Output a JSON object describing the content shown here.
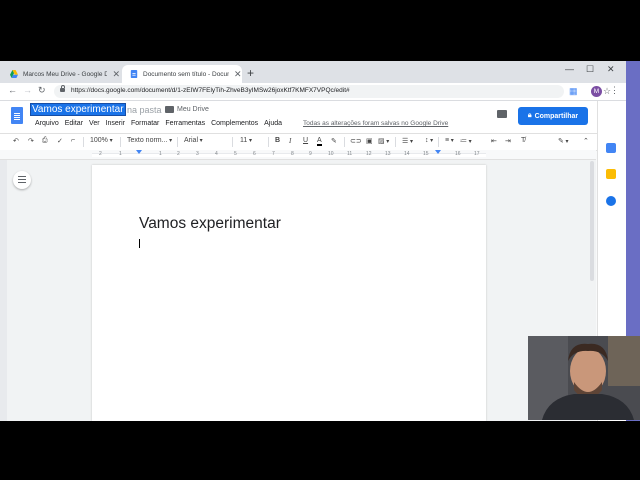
{
  "colors": {
    "accent": "#1a73e8",
    "avatar": "#7b4ea3",
    "docs_blue": "#4285f4"
  },
  "browser": {
    "tabs": [
      {
        "label": "Marcos Meu Drive - Google Drive",
        "icon": "google-drive-icon",
        "active": false
      },
      {
        "label": "Documento sem título - Docum",
        "icon": "google-docs-icon",
        "active": true
      }
    ],
    "url": "https://docs.google.com/document/d/1-zEIW7FElyTih-ZhveB3yIMSw26joxKtf7KMFX7VPQc/edit#",
    "profile_initial": "M"
  },
  "docs": {
    "title": "Vamos experimentar",
    "move_hint": "na pasta",
    "folder": "Meu Drive",
    "menu": [
      "Arquivo",
      "Editar",
      "Ver",
      "Inserir",
      "Formatar",
      "Ferramentas",
      "Complementos",
      "Ajuda"
    ],
    "saved_status": "Todas as alterações foram salvas no Google Drive",
    "share_label": "Compartilhar",
    "avatar_initial": "M",
    "toolbar": {
      "zoom": "100%",
      "style": "Texto norm...",
      "font": "Arial",
      "size": "11"
    },
    "ruler_numbers": [
      "2",
      "1",
      "1",
      "2",
      "3",
      "4",
      "5",
      "6",
      "7",
      "8",
      "9",
      "10",
      "11",
      "12",
      "13",
      "14",
      "15",
      "16",
      "17",
      "18"
    ],
    "content": {
      "heading": "Vamos experimentar"
    }
  }
}
